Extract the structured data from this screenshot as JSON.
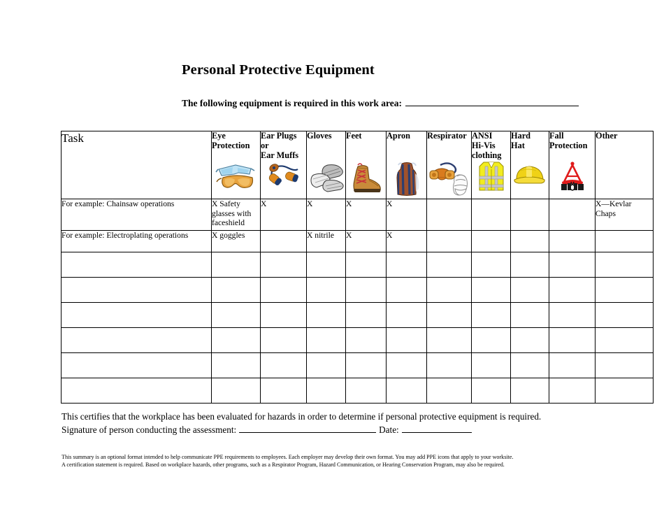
{
  "document": {
    "title": "Personal Protective Equipment",
    "subtitle_label": "The following equipment is required in this work area:"
  },
  "table": {
    "task_header": "Task",
    "columns": [
      {
        "label": "Eye\nProtection",
        "icon": "safety-glasses-icon"
      },
      {
        "label": "Ear Plugs\nor\nEar Muffs",
        "icon": "ear-plugs-icon"
      },
      {
        "label": "Gloves",
        "icon": "work-gloves-icon"
      },
      {
        "label": "Feet",
        "icon": "safety-boot-icon"
      },
      {
        "label": "Apron",
        "icon": "apron-icon"
      },
      {
        "label": "Respirator",
        "icon": "respirator-icon"
      },
      {
        "label": "ANSI\nHi-Vis\nclothing",
        "icon": "hi-vis-vest-icon"
      },
      {
        "label": "Hard\nHat",
        "icon": "hard-hat-icon"
      },
      {
        "label": "Fall\nProtection",
        "icon": "fall-harness-icon"
      },
      {
        "label": "Other",
        "icon": ""
      }
    ],
    "rows": [
      {
        "task": "For example: Chainsaw operations",
        "cells": [
          "X Safety glasses with faceshield",
          "X",
          "X",
          "X",
          "X",
          "",
          "",
          "",
          "",
          "X—Kevlar Chaps"
        ]
      },
      {
        "task": "For example: Electroplating operations",
        "cells": [
          "X goggles",
          "",
          "X nitrile",
          "X",
          "X",
          "",
          "",
          "",
          "",
          ""
        ]
      },
      {
        "task": "",
        "cells": [
          "",
          "",
          "",
          "",
          "",
          "",
          "",
          "",
          "",
          ""
        ]
      },
      {
        "task": "",
        "cells": [
          "",
          "",
          "",
          "",
          "",
          "",
          "",
          "",
          "",
          ""
        ]
      },
      {
        "task": "",
        "cells": [
          "",
          "",
          "",
          "",
          "",
          "",
          "",
          "",
          "",
          ""
        ]
      },
      {
        "task": "",
        "cells": [
          "",
          "",
          "",
          "",
          "",
          "",
          "",
          "",
          "",
          ""
        ]
      },
      {
        "task": "",
        "cells": [
          "",
          "",
          "",
          "",
          "",
          "",
          "",
          "",
          "",
          ""
        ]
      },
      {
        "task": "",
        "cells": [
          "",
          "",
          "",
          "",
          "",
          "",
          "",
          "",
          "",
          ""
        ]
      }
    ]
  },
  "certification": {
    "line1": "This certifies that the workplace has been evaluated for hazards in order to determine if personal protective equipment is required.",
    "signature_label": "Signature of person conducting the assessment:",
    "date_label": "Date:"
  },
  "footnote": {
    "line1": "This summary is an optional format intended to help communicate PPE requirements to employees. Each employer may develop their own format. You may add PPE icons that apply to your worksite.",
    "line2": "A certification statement is required. Based on workplace hazards,  other programs, such as a Respirator Program, Hazard Communication, or Hearing Conservation Program, may also be required."
  },
  "colors": {
    "border": "#000000",
    "glasses_blue": "#9fd4ef",
    "goggle_amber": "#e8a33d",
    "earplug_orange": "#e08a1e",
    "earplug_navy": "#1d3a6e",
    "glove_grey": "#d9d9d9",
    "boot_tan": "#c98b3a",
    "apron_brown": "#a0522d",
    "apron_navy": "#2c3e70",
    "vest_yellow": "#f2ec1f",
    "hardhat_yellow": "#f0d216",
    "harness_red": "#e01b1b"
  }
}
